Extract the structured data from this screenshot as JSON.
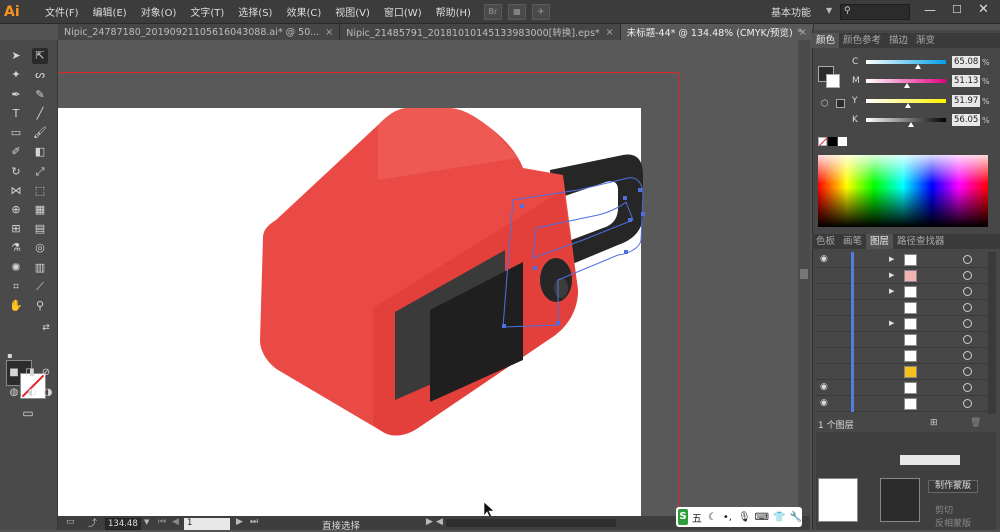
{
  "app": {
    "logo": "Ai",
    "menus": [
      "文件(F)",
      "编辑(E)",
      "对象(O)",
      "文字(T)",
      "选择(S)",
      "效果(C)",
      "视图(V)",
      "窗口(W)",
      "帮助(H)"
    ],
    "workspace": "基本功能",
    "toolbar_badge": "Br"
  },
  "tabs": [
    {
      "label": "Nipic_24787180_20190921105616043088.ai* @ 50...",
      "active": false
    },
    {
      "label": "Nipic_21485791_20181010145133983000[转换].eps*",
      "active": false
    },
    {
      "label": "未标题-44* @ 134.48% (CMYK/预览)",
      "active": true
    }
  ],
  "status": {
    "zoom": "134.48",
    "artboard": "1",
    "tool": "直接选择"
  },
  "panels": {
    "color_tabs": [
      "颜色",
      "颜色参考",
      "描边",
      "渐变"
    ],
    "cmyk": [
      {
        "label": "C",
        "value": "65.08",
        "pct": 65.08,
        "color_from": "#ffffff",
        "color_to": "#00a0e9"
      },
      {
        "label": "M",
        "value": "51.13",
        "pct": 51.13,
        "color_from": "#ffffff",
        "color_to": "#e4007f"
      },
      {
        "label": "Y",
        "value": "51.97",
        "pct": 51.97,
        "color_from": "#ffffff",
        "color_to": "#fff100"
      },
      {
        "label": "K",
        "value": "56.05",
        "pct": 56.05,
        "color_from": "#ffffff",
        "color_to": "#000000"
      }
    ],
    "pct_sign": "%",
    "layer_tabs": [
      "色板",
      "画笔",
      "图层",
      "路径查找器"
    ],
    "layer_count": "1 个图层",
    "cut_label": "制作蒙版",
    "mask_label1": "剪切",
    "mask_label2": "反相蒙版"
  },
  "ime": {
    "badge": "S",
    "mode": "五"
  },
  "colors": {
    "accent": "#e0262d",
    "body_red": "#ea4a45",
    "dark": "#2b2b2b"
  }
}
